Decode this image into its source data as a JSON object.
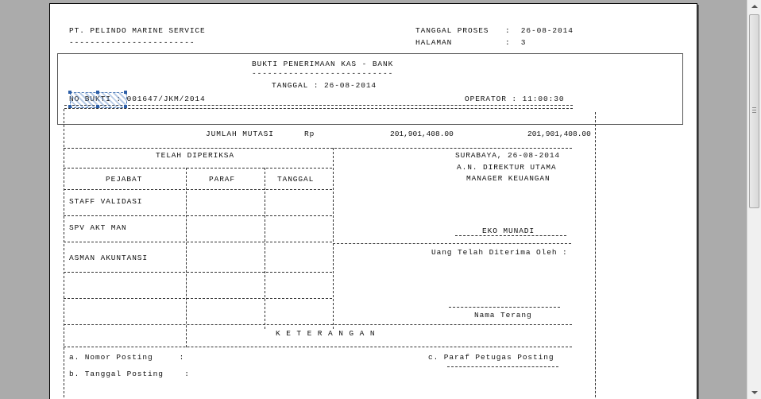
{
  "report": {
    "company": "PT. PELINDO MARINE SERVICE",
    "company_underline": "------------------------",
    "process_date_label": "TANGGAL PROSES",
    "process_date_value": ":  26-08-2014",
    "page_label": "HALAMAN",
    "page_value": ":  3",
    "title": "BUKTI PENERIMAAN KAS - BANK",
    "title_underline": "---------------------------",
    "date_line": "TANGGAL : 26-08-2014",
    "no_bukti": "NO BUKTI : 001647/JKM/2014",
    "operator": "OPERATOR : 11:00:30",
    "jumlah_mutasi_label": "JUMLAH MUTASI",
    "currency": "Rp",
    "amount_1": "201,901,408.00",
    "amount_2": "201,901,408.00",
    "checked_header": "TELAH DIPERIKSA",
    "col_pejabat": "PEJABAT",
    "col_paraf": "PARAF",
    "col_tanggal": "TANGGAL",
    "roles": [
      "STAFF VALIDASI",
      "SPV AKT MAN",
      "ASMAN AKUNTANSI"
    ],
    "city_date": "SURABAYA, 26-08-2014",
    "an_direktur": "A.N. DIREKTUR UTAMA",
    "manager": "MANAGER KEUANGAN",
    "signer": "EKO MUNADI",
    "received_by": "Uang Telah Diterima Oleh :",
    "nama_terang": "Nama Terang",
    "keterangan": "K E T E R A N G A N",
    "nomor_posting": "a. Nomor Posting     :",
    "tanggal_posting": "b. Tanggal Posting    :",
    "paraf_petugas": "c. Paraf Petugas Posting"
  },
  "colors": {
    "workspace": "#ababab",
    "paper": "#ffffff",
    "selection": "#4a78b5"
  },
  "icons": {
    "scroll_up": "triangle-up",
    "scroll_down": "triangle-down"
  }
}
